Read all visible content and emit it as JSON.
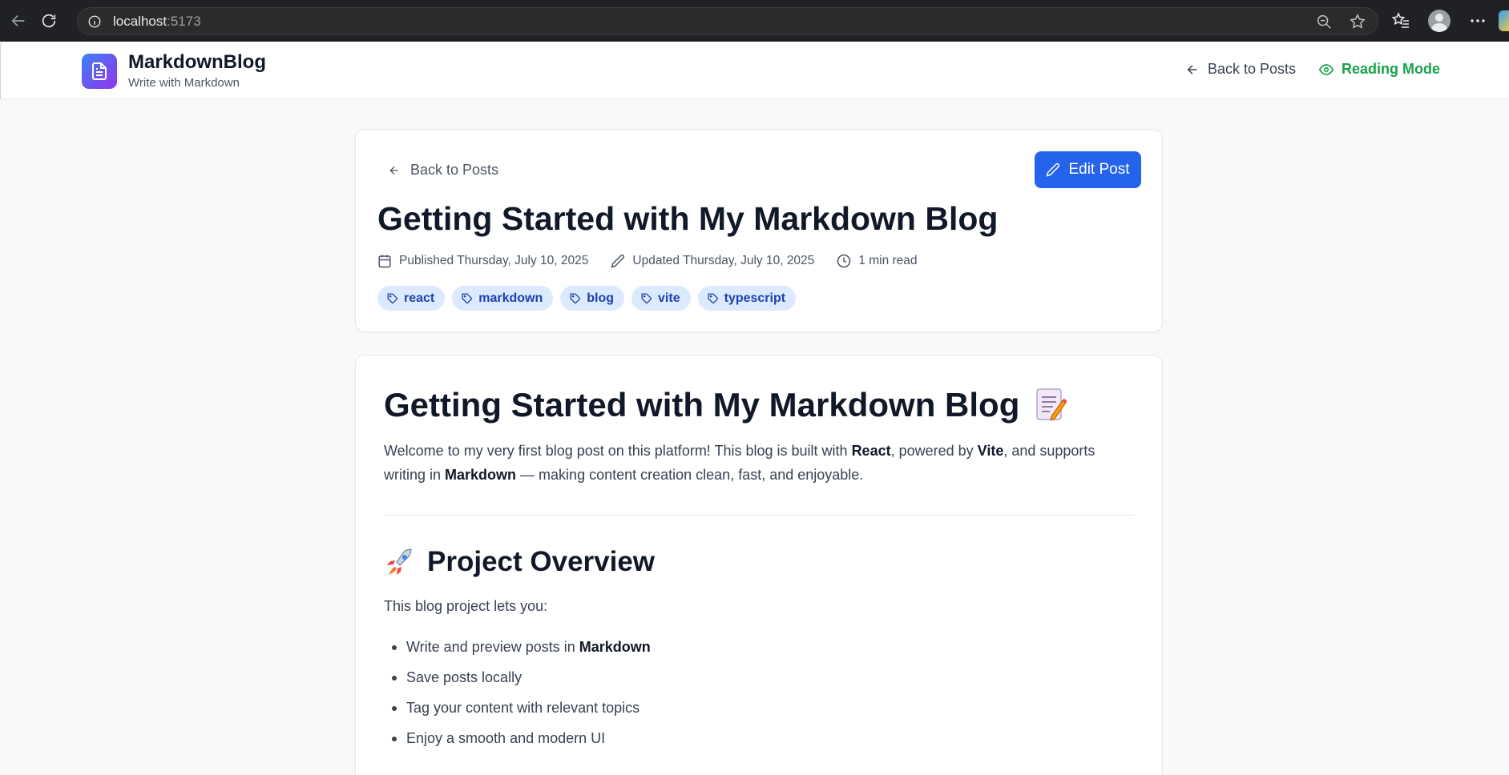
{
  "browser": {
    "url_host": "localhost",
    "url_port": ":5173"
  },
  "header": {
    "brand_title": "MarkdownBlog",
    "brand_subtitle": "Write with Markdown",
    "back_label": "Back to Posts",
    "reading_mode_label": "Reading Mode"
  },
  "post": {
    "back_label": "Back to Posts",
    "edit_label": "Edit Post",
    "title": "Getting Started with My Markdown Blog",
    "published": "Published Thursday, July 10, 2025",
    "updated": "Updated Thursday, July 10, 2025",
    "read_time": "1 min read",
    "tags": [
      "react",
      "markdown",
      "blog",
      "vite",
      "typescript"
    ]
  },
  "content": {
    "h1": "Getting Started with My Markdown Blog",
    "intro": {
      "t1": "Welcome to my very first blog post on this platform! This blog is built with ",
      "b1": "React",
      "t2": ", powered by ",
      "b2": "Vite",
      "t3": ", and supports writing in ",
      "b3": "Markdown",
      "t4": " — making content creation clean, fast, and enjoyable."
    },
    "h2": "Project Overview",
    "para": "This blog project lets you:",
    "list": [
      {
        "text": "Write and preview posts in ",
        "bold": "Markdown"
      },
      {
        "text": "Save posts locally",
        "bold": ""
      },
      {
        "text": "Tag your content with relevant topics",
        "bold": ""
      },
      {
        "text": "Enjoy a smooth and modern UI",
        "bold": ""
      }
    ]
  },
  "colors": {
    "primary": "#2563eb",
    "reading_mode": "#16a34a",
    "tag_bg": "#dbeafe",
    "tag_text": "#1e40af"
  }
}
